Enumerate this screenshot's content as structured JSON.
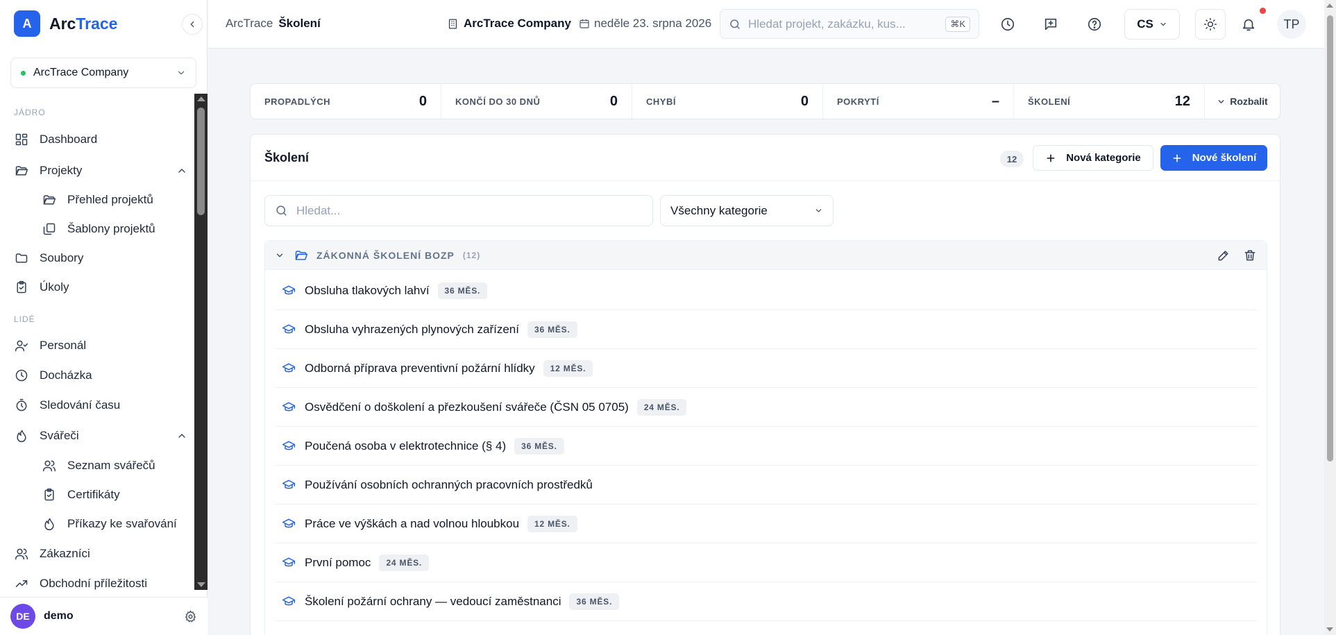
{
  "colors": {
    "accent": "#2563eb",
    "online": "#22c55e",
    "notification": "#ef4444",
    "avatar": "#6d4ae8"
  },
  "sidebar": {
    "logo_letter": "A",
    "logo_part1": "Arc",
    "logo_part2": "Trace",
    "company": "ArcTrace Company",
    "section_core": "JÁDRO",
    "section_people": "LIDÉ",
    "items": {
      "dashboard": "Dashboard",
      "projects": "Projekty",
      "projects_overview": "Přehled projektů",
      "project_templates": "Šablony projektů",
      "files": "Soubory",
      "tasks": "Úkoly",
      "personnel": "Personál",
      "attendance": "Docházka",
      "time_tracking": "Sledování času",
      "welders": "Svářeči",
      "welders_list": "Seznam svářečů",
      "certificates": "Certifikáty",
      "welding_orders": "Příkazy ke svařování",
      "customers": "Zákazníci",
      "opportunities": "Obchodní příležitosti"
    },
    "user": {
      "initials": "DE",
      "name": "demo"
    }
  },
  "topbar": {
    "breadcrumb_root": "ArcTrace",
    "breadcrumb_current": "Školení",
    "company": "ArcTrace Company",
    "separator": "·",
    "date": "neděle 23. srpna 2026",
    "search_placeholder": "Hledat projekt, zakázku, kus...",
    "search_shortcut": "⌘K",
    "language": "CS",
    "user_initials": "TP"
  },
  "stats": [
    {
      "label": "PROPADLÝCH",
      "value": "0"
    },
    {
      "label": "KONČÍ DO 30 DNŮ",
      "value": "0"
    },
    {
      "label": "CHYBÍ",
      "value": "0"
    },
    {
      "label": "POKRYTÍ",
      "value": "–"
    },
    {
      "label": "ŠKOLENÍ",
      "value": "12"
    }
  ],
  "expand_label": "Rozbalit",
  "card": {
    "title": "Školení",
    "count": "12",
    "new_category": "Nová kategorie",
    "new_training": "Nové školení",
    "search_placeholder": "Hledat...",
    "category_filter": "Všechny kategorie"
  },
  "group": {
    "title": "ZÁKONNÁ ŠKOLENÍ BOZP",
    "count": "(12)",
    "trainings": [
      {
        "name": "Obsluha tlakových lahví",
        "period": "36 MĚS."
      },
      {
        "name": "Obsluha vyhrazených plynových zařízení",
        "period": "36 MĚS."
      },
      {
        "name": "Odborná příprava preventivní požární hlídky",
        "period": "12 MĚS."
      },
      {
        "name": "Osvědčení o doškolení a přezkoušení svářeče (ČSN 05 0705)",
        "period": "24 MĚS."
      },
      {
        "name": "Poučená osoba v elektrotechnice (§ 4)",
        "period": "36 MĚS."
      },
      {
        "name": "Používání osobních ochranných pracovních prostředků",
        "period": ""
      },
      {
        "name": "Práce ve výškách a nad volnou hloubkou",
        "period": "12 MĚS."
      },
      {
        "name": "První pomoc",
        "period": "24 MĚS."
      },
      {
        "name": "Školení požární ochrany — vedoucí zaměstnanci",
        "period": "36 MĚS."
      }
    ]
  }
}
